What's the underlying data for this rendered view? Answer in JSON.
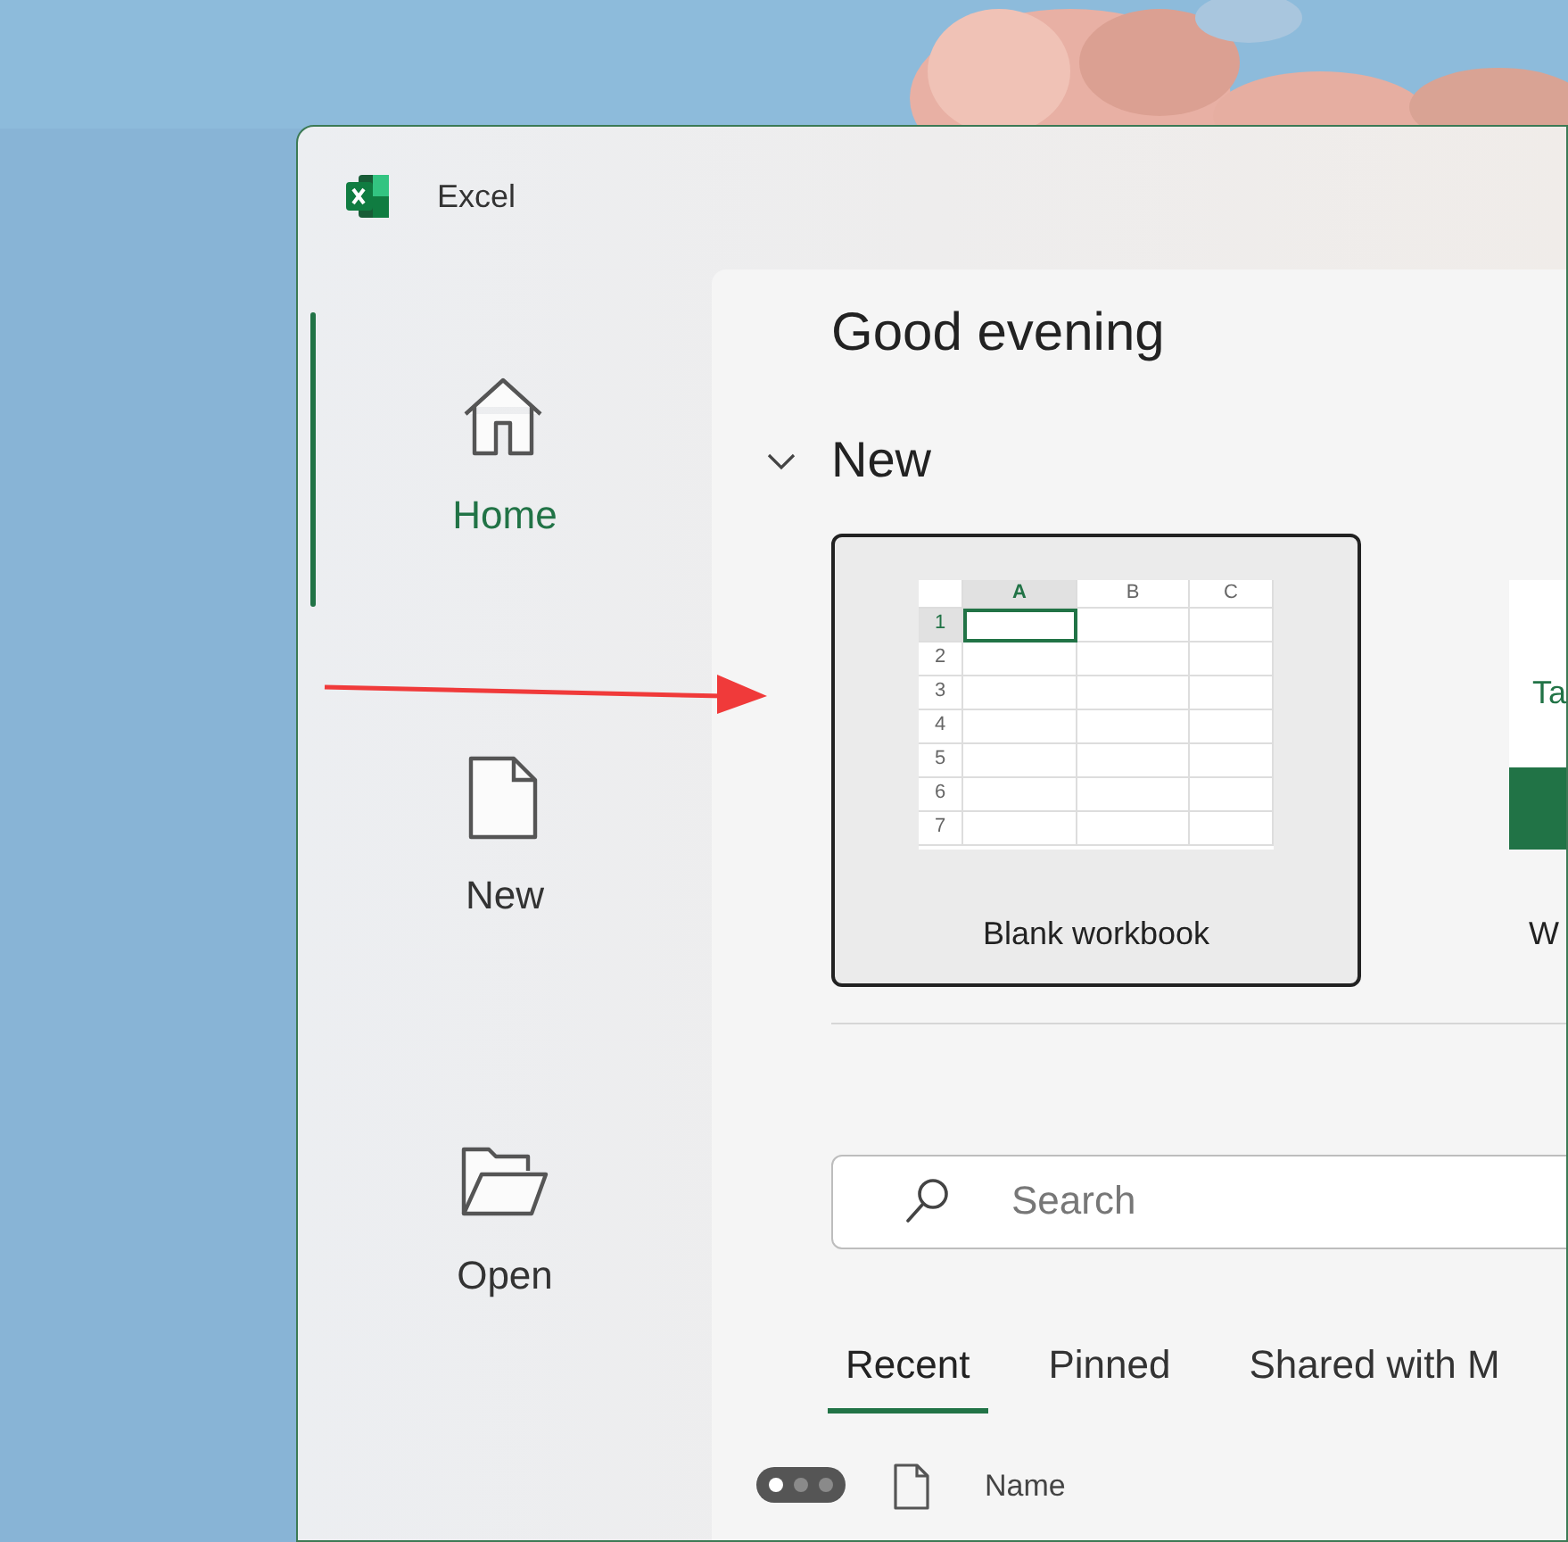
{
  "app": {
    "title": "Excel"
  },
  "sidebar": {
    "items": [
      {
        "label": "Home",
        "selected": true
      },
      {
        "label": "New",
        "selected": false
      },
      {
        "label": "Open",
        "selected": false
      }
    ]
  },
  "greeting": "Good evening",
  "new_section": {
    "title": "New",
    "expanded": true,
    "templates": [
      {
        "kind": "blank",
        "label": "Blank workbook",
        "selected": true,
        "columns": [
          "A",
          "B",
          "C"
        ],
        "rows": [
          "1",
          "2",
          "3",
          "4",
          "5",
          "6",
          "7"
        ]
      },
      {
        "kind": "preview",
        "label": "W",
        "preview_text": "Ta",
        "selected": false
      }
    ]
  },
  "search": {
    "placeholder": "Search"
  },
  "tabs": [
    {
      "label": "Recent",
      "selected": true
    },
    {
      "label": "Pinned",
      "selected": false
    },
    {
      "label": "Shared with M",
      "selected": false
    }
  ],
  "pager": {
    "dots": [
      {
        "selected": true
      },
      {
        "selected": false
      },
      {
        "selected": false
      }
    ]
  },
  "files": {
    "columns": [
      "Name"
    ]
  }
}
